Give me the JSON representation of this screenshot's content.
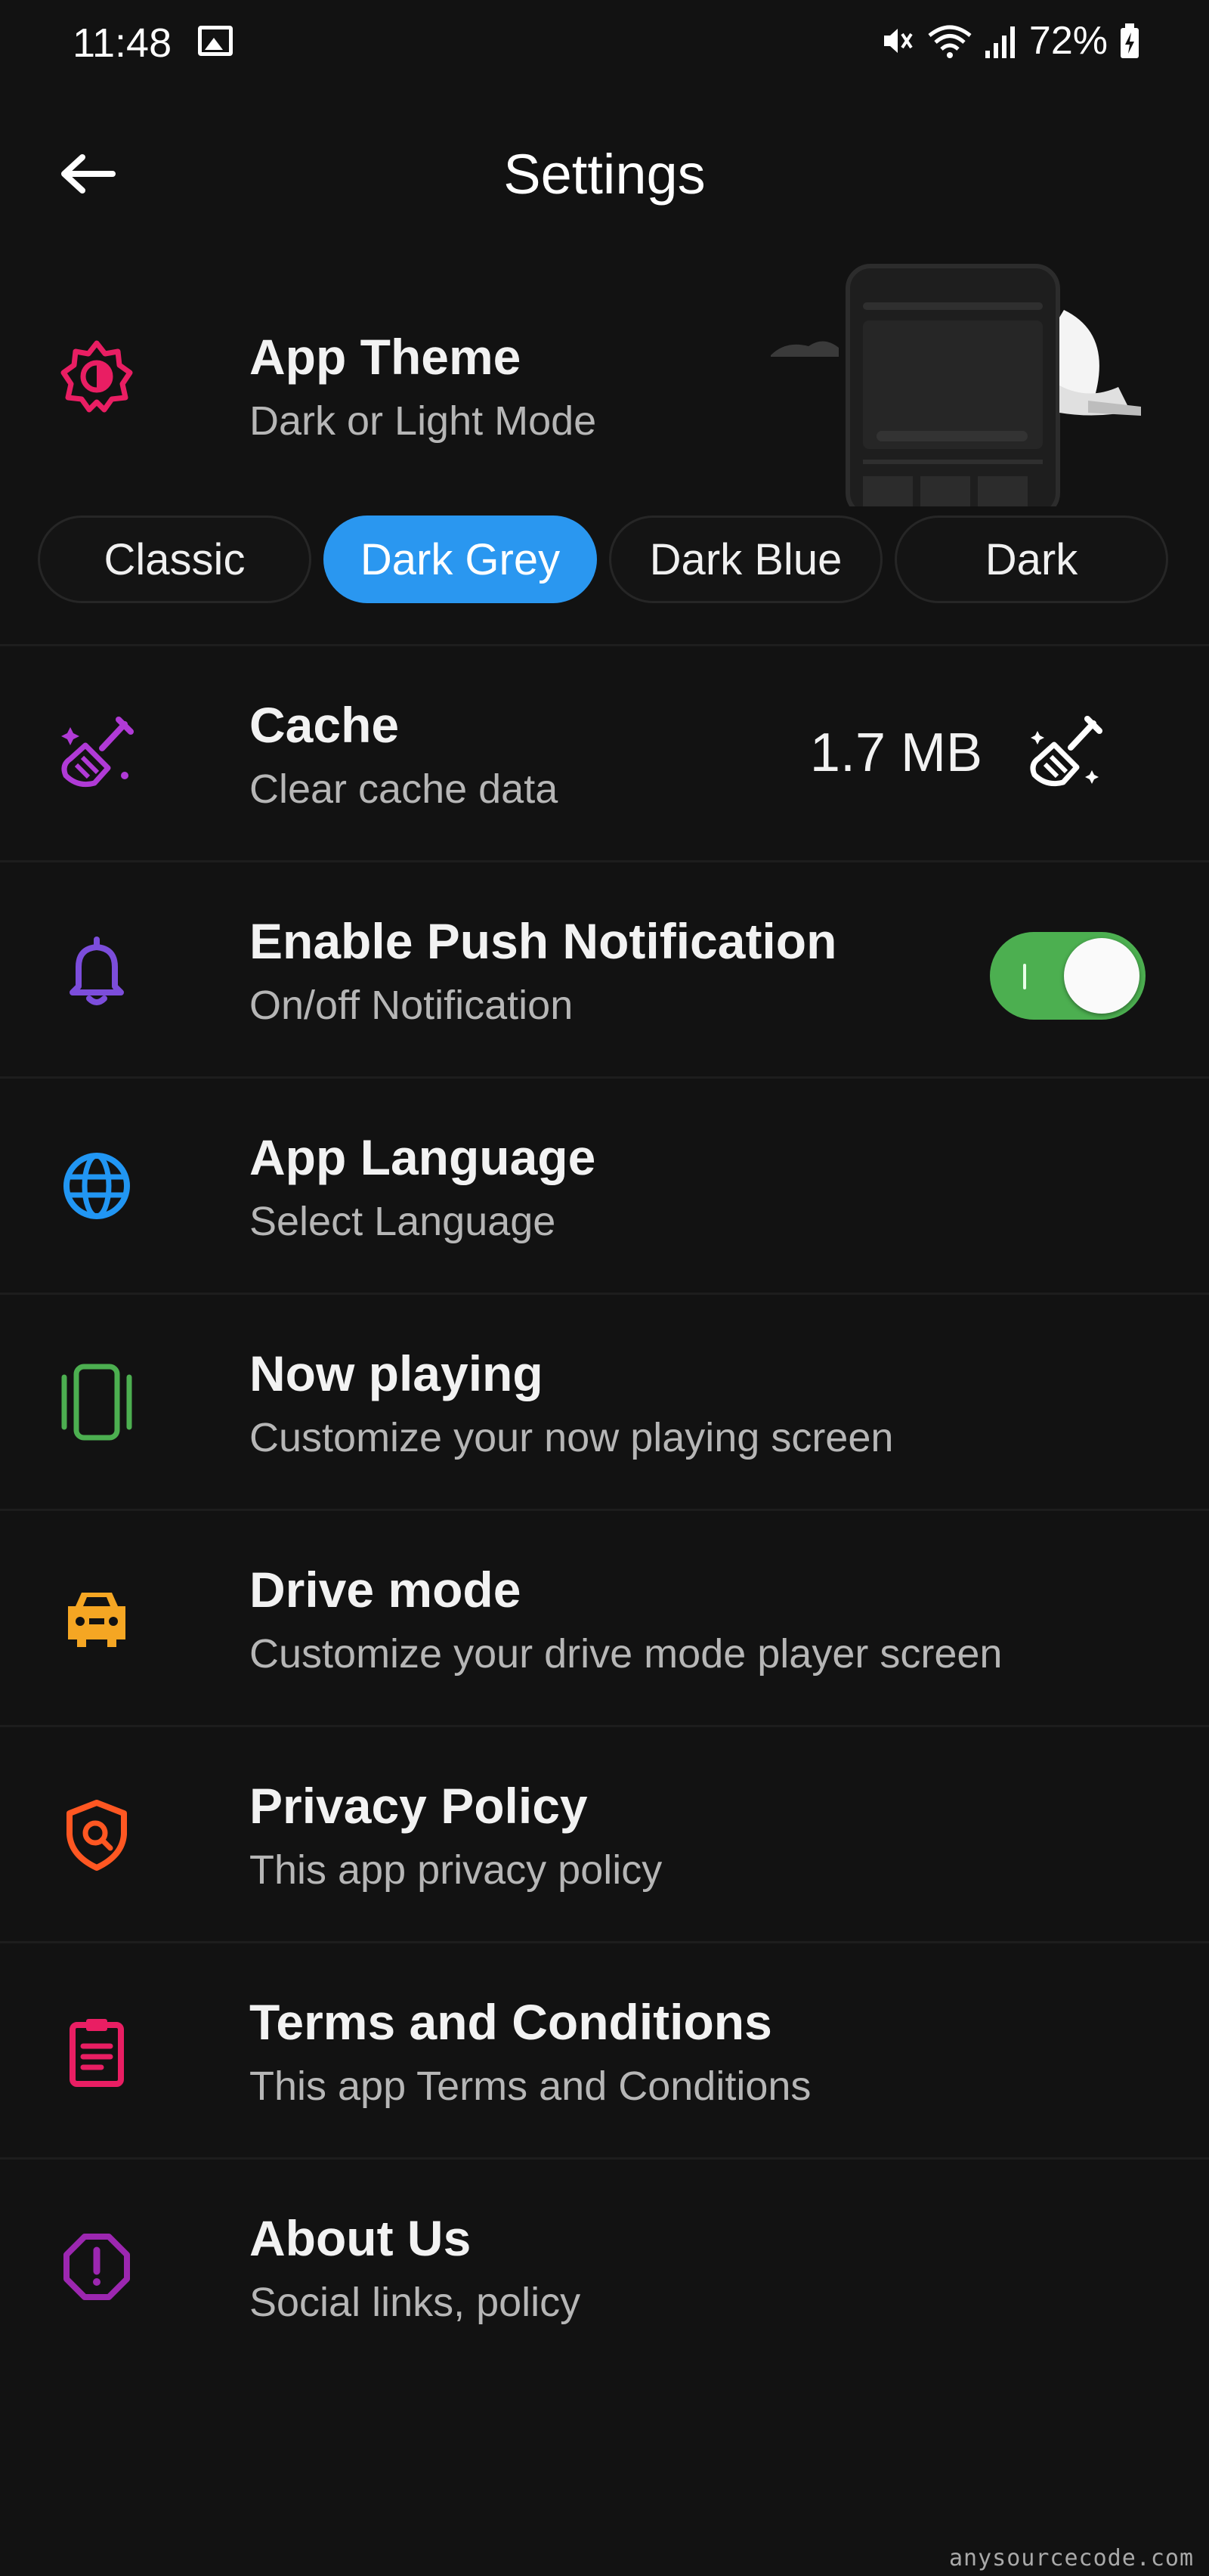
{
  "status_bar": {
    "time": "11:48",
    "battery": "72%",
    "icons": [
      "gallery-icon",
      "mute-icon",
      "wifi-icon",
      "signal-icon",
      "battery-icon"
    ]
  },
  "app_bar": {
    "title": "Settings",
    "back_icon": "arrow-left-icon"
  },
  "theme": {
    "title": "App Theme",
    "subtitle": "Dark or Light Mode",
    "icon": "brightness-icon",
    "icon_color": "#e91e63",
    "options": [
      {
        "label": "Classic",
        "selected": false
      },
      {
        "label": "Dark Grey",
        "selected": true
      },
      {
        "label": "Dark Blue",
        "selected": false
      },
      {
        "label": "Dark",
        "selected": false
      }
    ],
    "accent": "#2a97f0"
  },
  "settings": [
    {
      "title": "Cache",
      "subtitle": "Clear cache data",
      "icon": "broom-icon",
      "icon_color": "#b03ad6",
      "value": "1.7 MB",
      "action_icon": "clean-icon"
    },
    {
      "title": "Enable Push Notification",
      "subtitle": "On/off Notification",
      "icon": "bell-icon",
      "icon_color": "#7c4ddb",
      "toggle_on": true,
      "toggle_color": "#4caf50"
    },
    {
      "title": "App Language",
      "subtitle": "Select Language",
      "icon": "globe-icon",
      "icon_color": "#2196f3"
    },
    {
      "title": "Now playing",
      "subtitle": "Customize your now playing screen",
      "icon": "now-playing-icon",
      "icon_color": "#4caf50"
    },
    {
      "title": "Drive mode",
      "subtitle": "Customize your drive mode player screen",
      "icon": "car-icon",
      "icon_color": "#f5a623"
    },
    {
      "title": "Privacy Policy",
      "subtitle": "This app privacy policy",
      "icon": "shield-icon",
      "icon_color": "#ff5722"
    },
    {
      "title": "Terms and Conditions",
      "subtitle": "This app Terms and Conditions",
      "icon": "clipboard-icon",
      "icon_color": "#e91e63"
    },
    {
      "title": "About Us",
      "subtitle": "Social links, policy",
      "icon": "info-octagon-icon",
      "icon_color": "#9c27b0"
    }
  ],
  "watermark": "anysourcecode.com"
}
